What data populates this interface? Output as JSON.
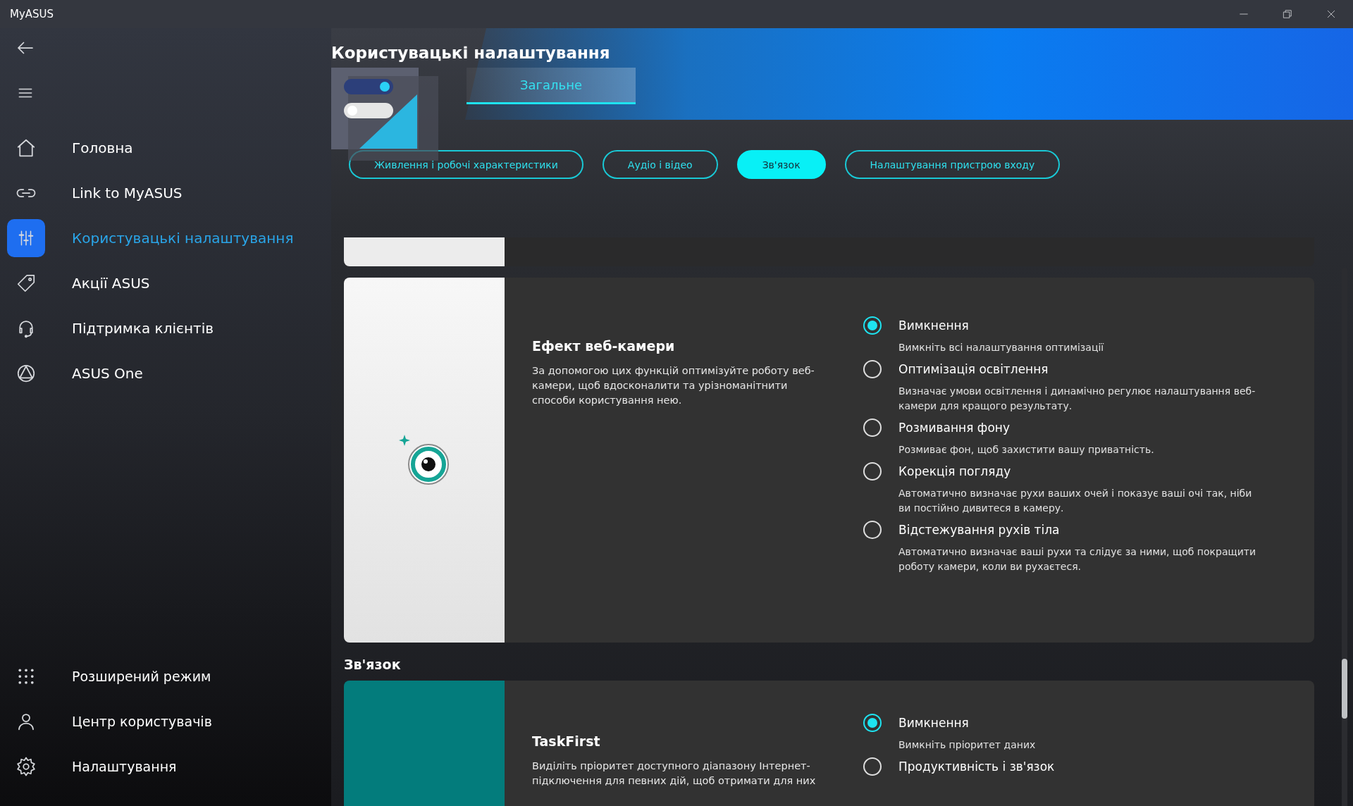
{
  "window": {
    "title": "MyASUS"
  },
  "sidebar": {
    "items": [
      {
        "label": "Головна",
        "selected": false
      },
      {
        "label": "Link to MyASUS",
        "selected": false
      },
      {
        "label": "Користувацькі налаштування",
        "selected": true
      },
      {
        "label": "Акції ASUS",
        "selected": false
      },
      {
        "label": "Підтримка клієнтів",
        "selected": false
      },
      {
        "label": "ASUS One",
        "selected": false
      }
    ],
    "bottom_items": [
      {
        "label": "Розширений режим",
        "selected": false
      },
      {
        "label": "Центр користувачів",
        "selected": false
      },
      {
        "label": "Налаштування",
        "selected": false
      }
    ]
  },
  "page": {
    "title": "Користувацькі налаштування",
    "tabs": [
      {
        "label": "Загальне",
        "selected": true
      }
    ],
    "filters": [
      {
        "label": "Живлення і робочі характеристики",
        "selected": false
      },
      {
        "label": "Аудіо і відео",
        "selected": false
      },
      {
        "label": "Зв'язок",
        "selected": true
      },
      {
        "label": "Налаштування пристрою входу",
        "selected": false
      }
    ]
  },
  "cards": [
    {
      "title": "Ефект веб-камери",
      "description": "За допомогою цих функцій оптимізуйте роботу веб-камери, щоб вдосконалити та урізноманітнити способи користування нею.",
      "options": [
        {
          "label": "Вимкнення",
          "description": "Вимкніть всі налаштування оптимізації",
          "selected": true
        },
        {
          "label": "Оптимізація освітлення",
          "description": "Визначає умови освітлення і динамічно регулює налаштування веб-камери для кращого результату.",
          "selected": false
        },
        {
          "label": "Розмивання фону",
          "description": "Розмиває фон, щоб захистити вашу приватність.",
          "selected": false
        },
        {
          "label": "Корекція погляду",
          "description": "Автоматично визначає рухи ваших очей і показує ваші очі так, ніби ви постійно дивитеся в камеру.",
          "selected": false
        },
        {
          "label": "Відстежування рухів тіла",
          "description": "Автоматично визначає ваші рухи та слідує за ними, щоб покращити роботу камери, коли ви рухаєтеся.",
          "selected": false
        }
      ]
    }
  ],
  "section": {
    "title": "Зв'язок"
  },
  "section_cards": [
    {
      "title": "TaskFirst",
      "description": "Виділіть пріоритет доступного діапазону Інтернет-підключення для певних дій, щоб отримати для них",
      "options": [
        {
          "label": "Вимкнення",
          "description": "Вимкніть пріоритет даних",
          "selected": true
        },
        {
          "label": "Продуктивність і зв'язок",
          "selected": false
        }
      ]
    }
  ]
}
